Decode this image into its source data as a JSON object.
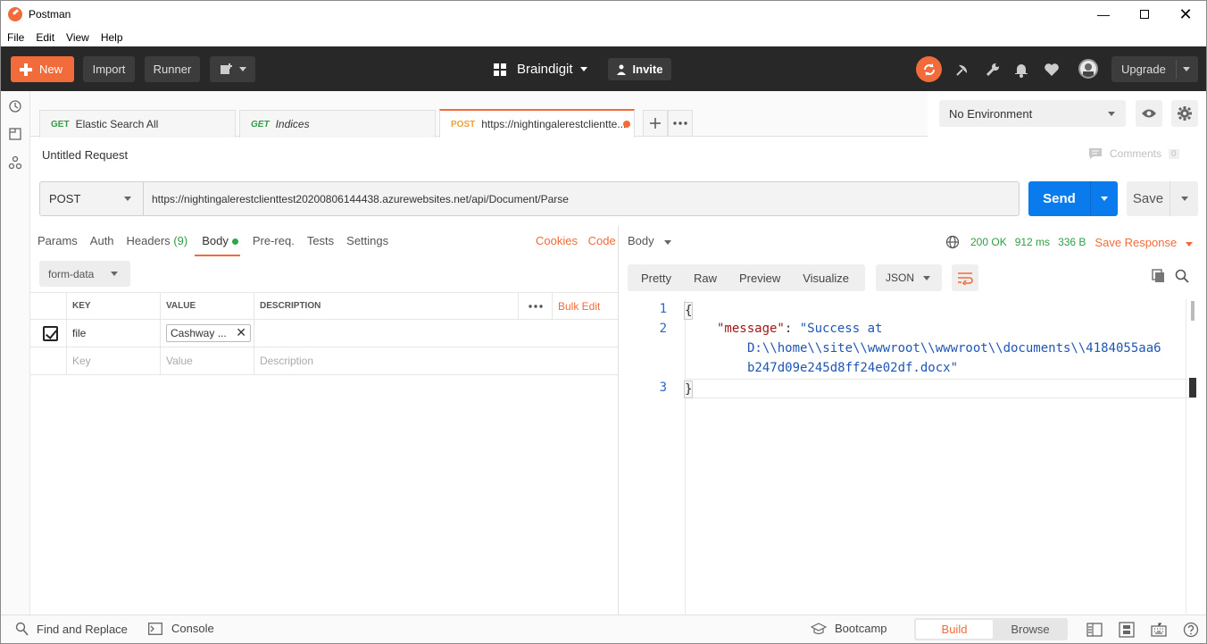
{
  "window": {
    "title": "Postman"
  },
  "menu": [
    "File",
    "Edit",
    "View",
    "Help"
  ],
  "header": {
    "new_label": "New",
    "import_label": "Import",
    "runner_label": "Runner",
    "workspace": "Braindigit",
    "invite_label": "Invite",
    "upgrade_label": "Upgrade"
  },
  "tabs": [
    {
      "method": "GET",
      "name": "Elastic Search All",
      "method_color": "#2f9e44"
    },
    {
      "method": "GET",
      "name": "Indices",
      "method_color": "#2f9e44"
    },
    {
      "method": "POST",
      "name": "https://nightingalerestclientte...",
      "method_color": "#f2a035"
    }
  ],
  "environment": {
    "selected": "No Environment"
  },
  "request": {
    "name": "Untitled Request",
    "comments_label": "Comments",
    "comments_count": "0",
    "method": "POST",
    "url": "https://nightingalerestclienttest20200806144438.azurewebsites.net/api/Document/Parse",
    "send_label": "Send",
    "save_label": "Save"
  },
  "request_tabs": {
    "params": "Params",
    "auth": "Auth",
    "headers": "Headers",
    "headers_count": "(9)",
    "body": "Body",
    "prereq": "Pre-req.",
    "tests": "Tests",
    "settings": "Settings",
    "cookies": "Cookies",
    "code": "Code"
  },
  "body": {
    "mode": "form-data",
    "columns": {
      "key": "KEY",
      "value": "VALUE",
      "description": "DESCRIPTION"
    },
    "bulk_edit": "Bulk Edit",
    "rows": [
      {
        "key": "file",
        "value": "Cashway ..."
      }
    ],
    "placeholders": {
      "key": "Key",
      "value": "Value",
      "description": "Description"
    }
  },
  "response": {
    "body_label": "Body",
    "status": "200 OK",
    "time": "912 ms",
    "size": "336 B",
    "save_response": "Save Response",
    "formats": [
      "Pretty",
      "Raw",
      "Preview",
      "Visualize"
    ],
    "language": "JSON",
    "lines": [
      {
        "num": "1",
        "text": "{"
      },
      {
        "num": "2",
        "key": "\"message\"",
        "sep": ": ",
        "value_line1": "\"Success at",
        "value_line2": "D:\\\\home\\\\site\\\\wwwroot\\\\wwwroot\\\\documents\\\\4184055aa6",
        "value_line3": "b247d09e245d8ff24e02df.docx\""
      },
      {
        "num": "3",
        "text": "}"
      }
    ]
  },
  "footer": {
    "find_replace": "Find and Replace",
    "console": "Console",
    "bootcamp": "Bootcamp",
    "build": "Build",
    "browse": "Browse"
  },
  "colors": {
    "accent": "#f26b3a",
    "send": "#097bed",
    "header_bg": "#282828"
  }
}
